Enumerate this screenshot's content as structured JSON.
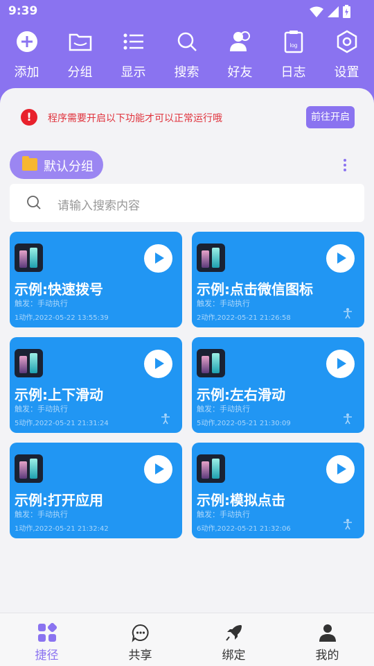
{
  "status_bar": {
    "time": "9:39"
  },
  "toolbar": [
    {
      "label": "添加",
      "icon": "add-circle-icon"
    },
    {
      "label": "分组",
      "icon": "folder-icon"
    },
    {
      "label": "显示",
      "icon": "list-icon"
    },
    {
      "label": "搜索",
      "icon": "search-icon"
    },
    {
      "label": "好友",
      "icon": "friends-icon"
    },
    {
      "label": "日志",
      "icon": "log-icon"
    },
    {
      "label": "设置",
      "icon": "settings-icon"
    }
  ],
  "log_icon_text": "log",
  "notice": {
    "text": "程序需要开启以下功能才可以正常运行哦",
    "button": "前往开启",
    "icon_glyph": "!"
  },
  "group": {
    "label": "默认分组"
  },
  "search": {
    "placeholder": "请输入搜索内容"
  },
  "cards": [
    {
      "title": "示例:快速拨号",
      "trigger": "触发：手动执行",
      "meta": "1动作,2022-05-22 13:55:39",
      "accessibility": false
    },
    {
      "title": "示例:点击微信图标",
      "trigger": "触发：手动执行",
      "meta": "2动作,2022-05-21 21:26:58",
      "accessibility": true
    },
    {
      "title": "示例:上下滑动",
      "trigger": "触发：手动执行",
      "meta": "5动作,2022-05-21 21:31:24",
      "accessibility": true
    },
    {
      "title": "示例:左右滑动",
      "trigger": "触发：手动执行",
      "meta": "5动作,2022-05-21 21:30:09",
      "accessibility": true
    },
    {
      "title": "示例:打开应用",
      "trigger": "触发：手动执行",
      "meta": "1动作,2022-05-21 21:32:42",
      "accessibility": false
    },
    {
      "title": "示例:模拟点击",
      "trigger": "触发：手动执行",
      "meta": "6动作,2022-05-21 21:32:06",
      "accessibility": true
    }
  ],
  "bottom_nav": [
    {
      "label": "捷径",
      "icon": "shortcuts-icon",
      "active": true
    },
    {
      "label": "共享",
      "icon": "chat-icon",
      "active": false
    },
    {
      "label": "绑定",
      "icon": "rocket-icon",
      "active": false
    },
    {
      "label": "我的",
      "icon": "profile-icon",
      "active": false
    }
  ],
  "colors": {
    "accent": "#8a73f0",
    "card": "#2196f3",
    "alert": "#e8212c"
  }
}
